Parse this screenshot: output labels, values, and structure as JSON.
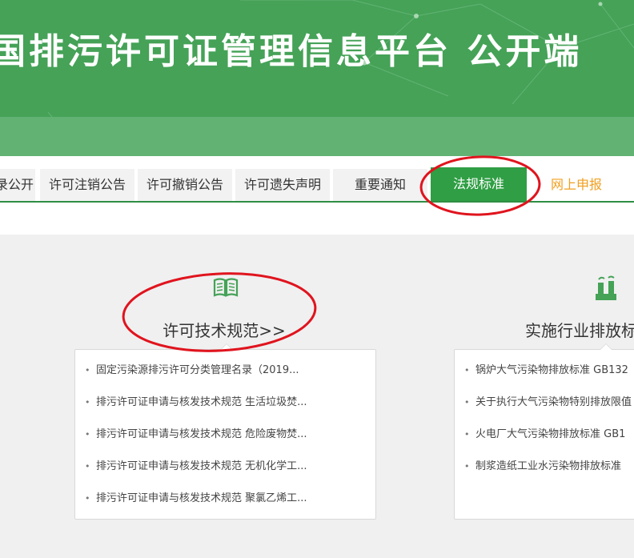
{
  "header": {
    "title": "国排污许可证管理信息平台  公开端"
  },
  "nav": {
    "tabs": [
      {
        "label": "录公开",
        "state": "normal"
      },
      {
        "label": "许可注销公告",
        "state": "normal"
      },
      {
        "label": "许可撤销公告",
        "state": "normal"
      },
      {
        "label": "许可遗失声明",
        "state": "normal"
      },
      {
        "label": "重要通知",
        "state": "normal"
      },
      {
        "label": "法规标准",
        "state": "active"
      },
      {
        "label": "网上申报",
        "state": "link"
      }
    ]
  },
  "columns": [
    {
      "icon": "book-icon",
      "title": "许可技术规范>>",
      "items": [
        "固定污染源排污许可分类管理名录（2019...",
        "排污许可证申请与核发技术规范 生活垃圾焚...",
        "排污许可证申请与核发技术规范 危险废物焚...",
        "排污许可证申请与核发技术规范 无机化学工...",
        "排污许可证申请与核发技术规范 聚氯乙烯工..."
      ]
    },
    {
      "icon": "factory-icon",
      "title": "实施行业排放标",
      "items": [
        "锅炉大气污染物排放标准 GB132",
        "关于执行大气污染物特别排放限值",
        "火电厂大气污染物排放标准 GB1",
        "制浆造纸工业水污染物排放标准"
      ]
    }
  ],
  "colors": {
    "banner": "#45a257",
    "banner_band": "#62b274",
    "active_tab": "#2f9e44",
    "nav_line": "#2f8e45",
    "online_tab_text": "#f0a020",
    "annotation": "#e0141e",
    "icon": "#45a257"
  }
}
